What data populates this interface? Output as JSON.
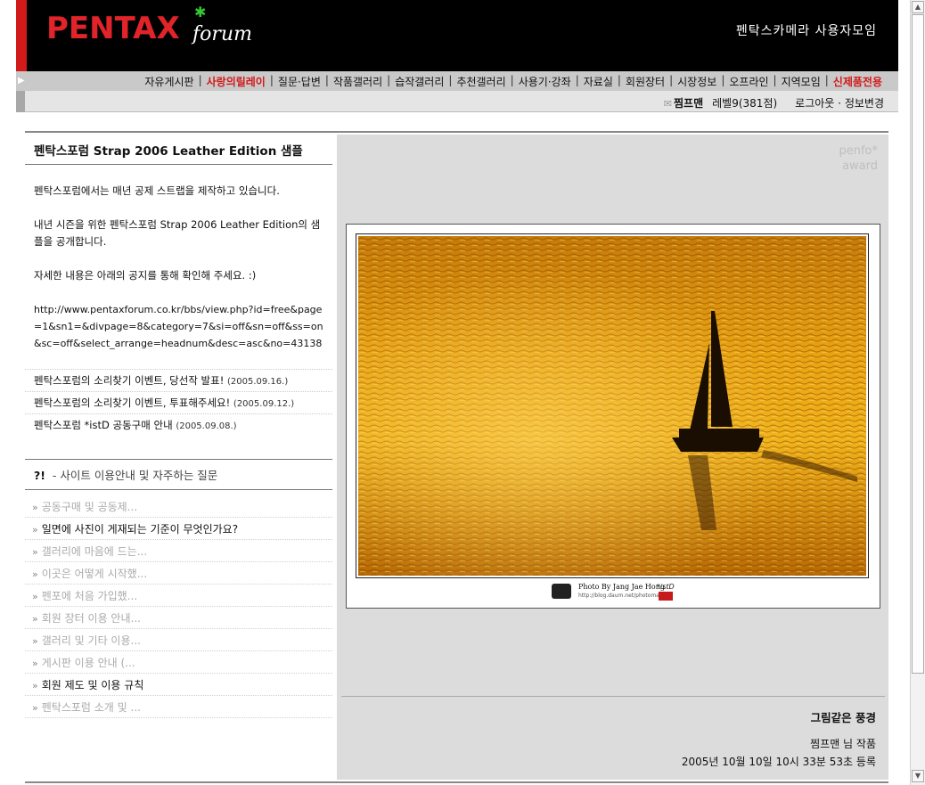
{
  "header": {
    "logo_text": "PENTAX",
    "logo_sub": "forum",
    "tagline": "펜탁스카메라 사용자모임"
  },
  "nav": {
    "items": [
      {
        "label": "자유게시판",
        "highlight": false
      },
      {
        "label": "사랑의릴레이",
        "highlight": true
      },
      {
        "label": "질문·답변",
        "highlight": false
      },
      {
        "label": "작품갤러리",
        "highlight": false
      },
      {
        "label": "습작갤러리",
        "highlight": false
      },
      {
        "label": "추천갤러리",
        "highlight": false
      },
      {
        "label": "사용기·강좌",
        "highlight": false
      },
      {
        "label": "자료실",
        "highlight": false
      },
      {
        "label": "회원장터",
        "highlight": false
      },
      {
        "label": "시장정보",
        "highlight": false
      },
      {
        "label": "오프라인",
        "highlight": false
      },
      {
        "label": "지역모임",
        "highlight": false
      },
      {
        "label": "신제품전용",
        "highlight": true
      }
    ]
  },
  "user": {
    "name": "찜프맨",
    "level": "레벨9(381점)",
    "logout": "로그아웃",
    "sep": "·",
    "edit_info": "정보변경"
  },
  "news": {
    "title": "펜탁스포럼 Strap 2006 Leather Edition 샘플",
    "para1": "펜탁스포럼에서는 매년 공제 스트랩을 제작하고 있습니다.",
    "para2": "내년 시즌을 위한 펜탁스포럼 Strap 2006 Leather Edition의 샘플을 공개합니다.",
    "para3": "자세한 내용은 아래의 공지를 통해 확인해 주세요. :)",
    "url": "http://www.pentaxforum.co.kr/bbs/view.php?id=free&page=1&sn1=&divpage=8&category=7&si=off&sn=off&ss=on&sc=off&select_arrange=headnum&desc=asc&no=43138",
    "items": [
      {
        "title": "펜탁스포럼의 소리찾기 이벤트, 당선작 발표!",
        "date": "(2005.09.16.)"
      },
      {
        "title": "펜탁스포럼의 소리찾기 이벤트, 투표해주세요!",
        "date": "(2005.09.12.)"
      },
      {
        "title": "펜탁스포럼 *istD 공동구매 안내",
        "date": "(2005.09.08.)"
      }
    ]
  },
  "faq": {
    "mark": "?!",
    "title": " - 사이트 이용안내 및 자주하는 질문",
    "arrow": "»",
    "items": [
      {
        "label": "공동구매 및 공동제...",
        "dark": false
      },
      {
        "label": "일면에 사진이 게재되는 기준이 무엇인가요?",
        "dark": true
      },
      {
        "label": "갤러리에 마음에 드는...",
        "dark": false
      },
      {
        "label": "이곳은 어떻게 시작했...",
        "dark": false
      },
      {
        "label": "펜포에 처음 가입했...",
        "dark": false
      },
      {
        "label": "회원 장터 이용 안내...",
        "dark": false
      },
      {
        "label": "갤러리 및 기타 이용...",
        "dark": false
      },
      {
        "label": "게시판 이용 안내 (...",
        "dark": false
      },
      {
        "label": "회원 제도 및 이용 규칙",
        "dark": true
      },
      {
        "label": "펜탁스포럼 소개 및 ...",
        "dark": false
      }
    ]
  },
  "award": {
    "line1": "penfo*",
    "line2": "award"
  },
  "photo": {
    "credit_line1": "Photo By Jang Jae Hong",
    "credit_line2": "http://blog.daum.net/photoman76",
    "credit_mark": "*istD",
    "title": "그림같은 풍경",
    "author": "찜프맨 님 작품",
    "date": "2005년 10월 10일 10시 33분 53초 등록"
  },
  "colors": {
    "brand_red": "#d11a1a",
    "header_bg": "#000000",
    "panel_bg": "#dcdcdc"
  }
}
